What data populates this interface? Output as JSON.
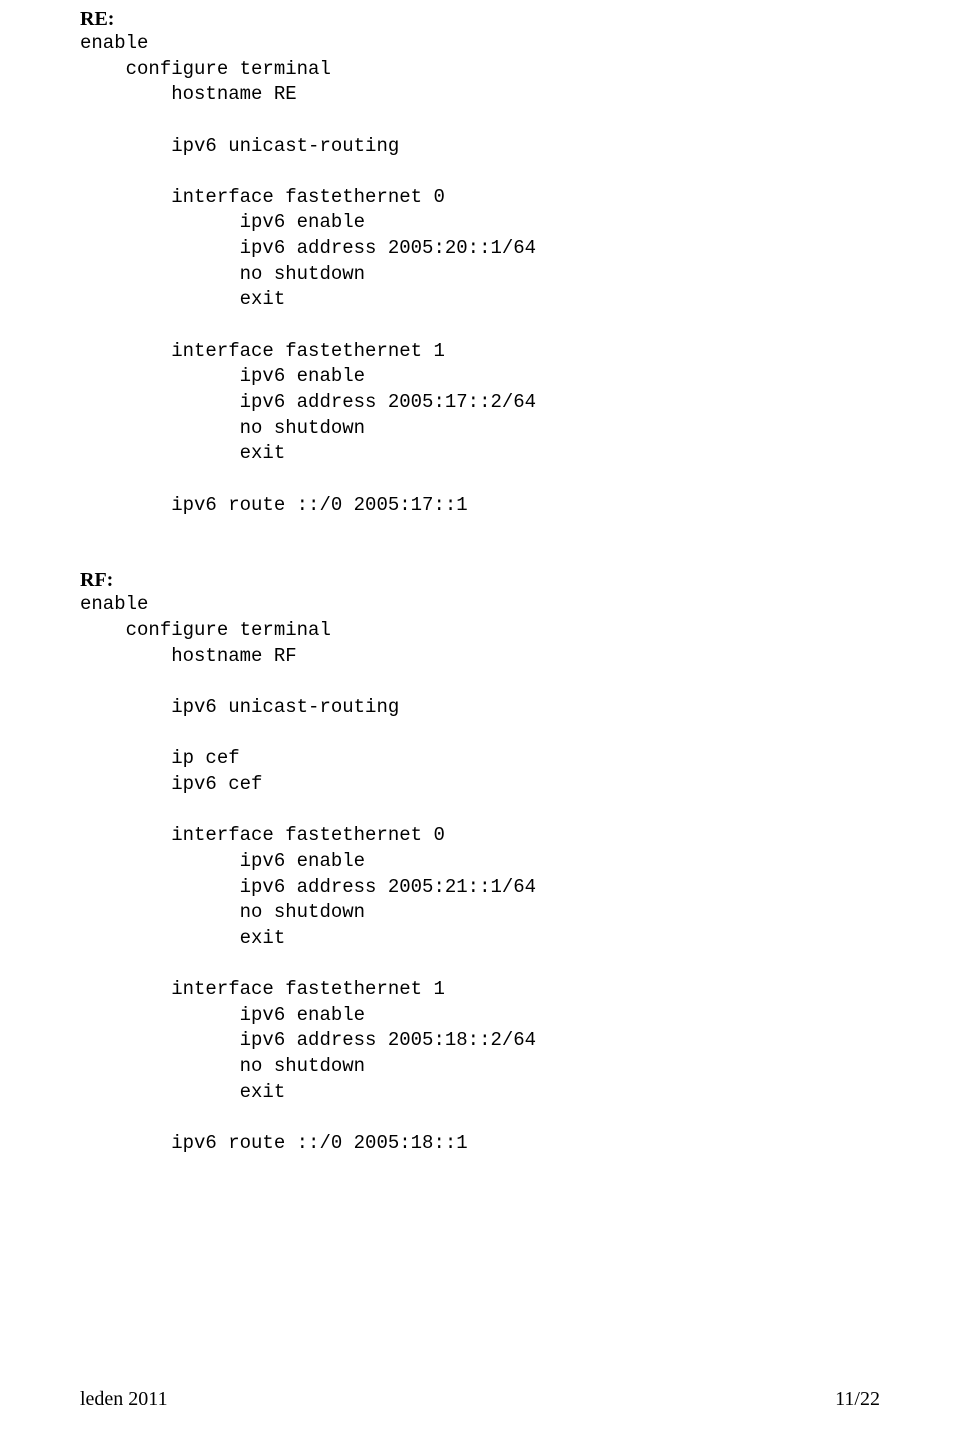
{
  "re": {
    "label": "RE:",
    "enable": "enable",
    "config_terminal": "    configure terminal",
    "hostname": "        hostname RE",
    "unicast": "        ipv6 unicast-routing",
    "if0_header": "        interface fastethernet 0",
    "if0_enable": "              ipv6 enable",
    "if0_addr": "              ipv6 address 2005:20::1/64",
    "if0_shutdown": "              no shutdown",
    "if0_exit": "              exit",
    "if1_header": "        interface fastethernet 1",
    "if1_enable": "              ipv6 enable",
    "if1_addr": "              ipv6 address 2005:17::2/64",
    "if1_shutdown": "              no shutdown",
    "if1_exit": "              exit",
    "route": "        ipv6 route ::/0 2005:17::1"
  },
  "rf": {
    "label": "RF:",
    "enable": "enable",
    "config_terminal": "    configure terminal",
    "hostname": "        hostname RF",
    "unicast": "        ipv6 unicast-routing",
    "ipcef": "        ip cef",
    "ipv6cef": "        ipv6 cef",
    "if0_header": "        interface fastethernet 0",
    "if0_enable": "              ipv6 enable",
    "if0_addr": "              ipv6 address 2005:21::1/64",
    "if0_shutdown": "              no shutdown",
    "if0_exit": "              exit",
    "if1_header": "        interface fastethernet 1",
    "if1_enable": "              ipv6 enable",
    "if1_addr": "              ipv6 address 2005:18::2/64",
    "if1_shutdown": "              no shutdown",
    "if1_exit": "              exit",
    "route": "        ipv6 route ::/0 2005:18::1"
  },
  "footer": {
    "left": "leden 2011",
    "right": "11/22"
  }
}
